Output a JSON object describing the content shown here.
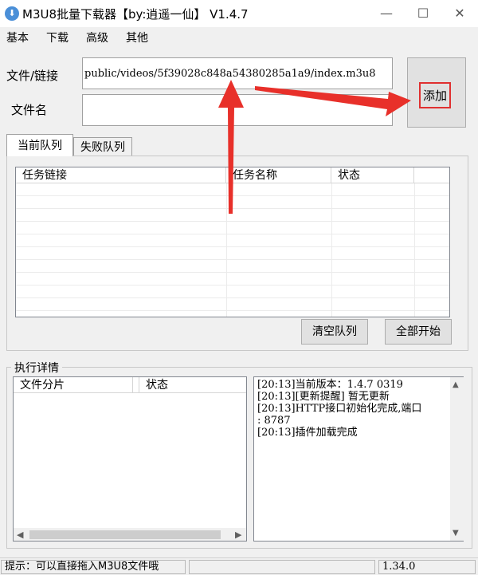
{
  "window": {
    "title": "M3U8批量下载器【by:逍遥一仙】  V1.4.7",
    "minimize": "—",
    "maximize": "☐",
    "close": "✕"
  },
  "menu": [
    "基本",
    "下载",
    "高级",
    "其他"
  ],
  "form": {
    "url_label": "文件/链接",
    "url_value": "public/videos/5f39028c848a54380285a1a9/index.m3u8",
    "name_label": "文件名",
    "name_value": "",
    "add_button": "添加"
  },
  "tabs": [
    "当前队列",
    "失败队列"
  ],
  "queue": {
    "columns": [
      "任务链接",
      "任务名称",
      "状态"
    ],
    "clear_button": "清空队列",
    "start_all_button": "全部开始"
  },
  "exec": {
    "title": "执行详情",
    "columns": [
      "文件分片",
      "状态"
    ],
    "log": [
      "[20:13]当前版本：1.4.7 0319",
      "[20:13][更新提醒] 暂无更新",
      "[20:13]HTTP接口初始化完成,端口",
      ": 8787",
      "[20:13]插件加载完成"
    ]
  },
  "status": {
    "hint": "提示：可以直接拖入M3U8文件哦",
    "version": "1.34.0"
  },
  "colors": {
    "annotation_red": "#e8302a",
    "add_outline": "#e03030"
  }
}
